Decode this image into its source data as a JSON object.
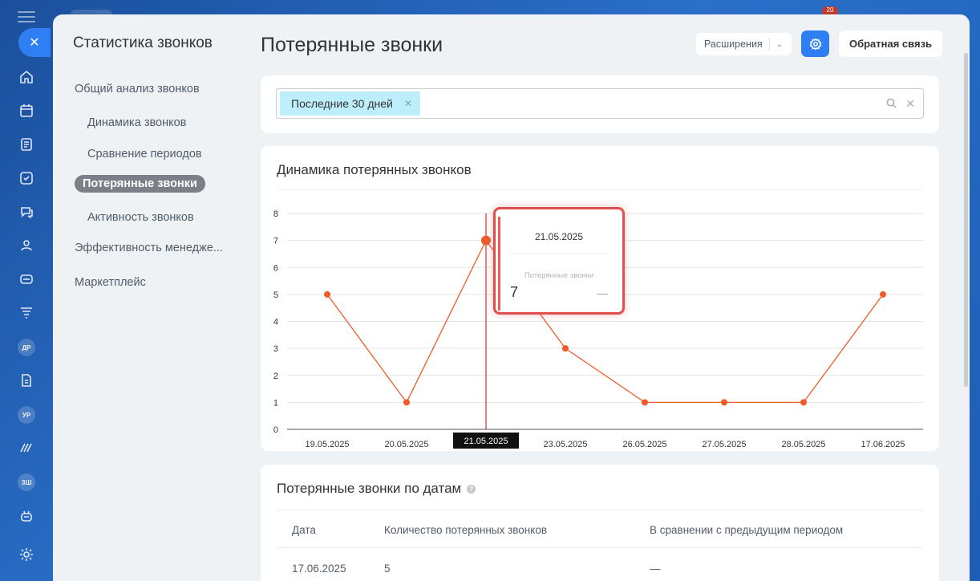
{
  "sidebar_rail": {
    "avatars": [
      "ДР",
      "УР",
      "ЗШ"
    ],
    "top_badge": "20"
  },
  "nav": {
    "title": "Статистика звонков",
    "items": [
      {
        "label": "Общий анализ звонков",
        "level": 0
      },
      {
        "label": "Динамика звонков",
        "level": 1
      },
      {
        "label": "Сравнение периодов",
        "level": 1
      },
      {
        "label": "Потерянные звонки",
        "level": 1,
        "active": true
      },
      {
        "label": "Активность звонков",
        "level": 1
      },
      {
        "label": "Эффективность менедже...",
        "level": 0
      },
      {
        "label": "Маркетплейс",
        "level": 0
      }
    ]
  },
  "header": {
    "title": "Потерянные звонки",
    "extensions_label": "Расширения",
    "feedback_label": "Обратная связь"
  },
  "filter": {
    "chip_label": "Последние 30 дней"
  },
  "chart_section": {
    "title": "Динамика потерянных звонков",
    "tooltip": {
      "date": "21.05.2025",
      "series_label": "Потерянные звонки",
      "value": "7",
      "delta": "—"
    },
    "x_highlight_label": "21.05.2025"
  },
  "chart_data": {
    "type": "line",
    "categories": [
      "19.05.2025",
      "20.05.2025",
      "21.05.2025",
      "23.05.2025",
      "26.05.2025",
      "27.05.2025",
      "28.05.2025",
      "17.06.2025"
    ],
    "values": [
      5,
      1,
      7,
      3,
      1,
      1,
      1,
      5
    ],
    "ylim": [
      0,
      8
    ],
    "yticks": [
      0,
      1,
      2,
      3,
      4,
      5,
      6,
      7,
      8
    ],
    "color": "#f05b2b",
    "highlight_index": 2
  },
  "table": {
    "title": "Потерянные звонки по датам",
    "columns": [
      "Дата",
      "Количество потерянных звонков",
      "В сравнении с предыдущим периодом"
    ],
    "rows": [
      [
        "17.06.2025",
        "5",
        "—"
      ]
    ]
  }
}
